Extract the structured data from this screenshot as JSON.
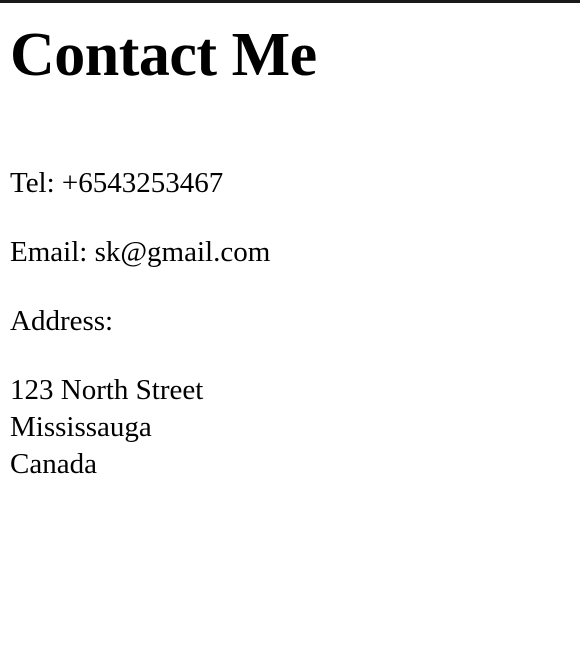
{
  "page": {
    "heading": "Contact Me",
    "tel": "Tel: +6543253467",
    "email": "Email: sk@gmail.com",
    "address_label": "Address:",
    "address_lines": [
      "123 North Street",
      "Mississauga",
      "Canada"
    ]
  },
  "colors": {
    "background": "#ffffff",
    "text": "#000000",
    "top_border": "#1a1a1a"
  }
}
